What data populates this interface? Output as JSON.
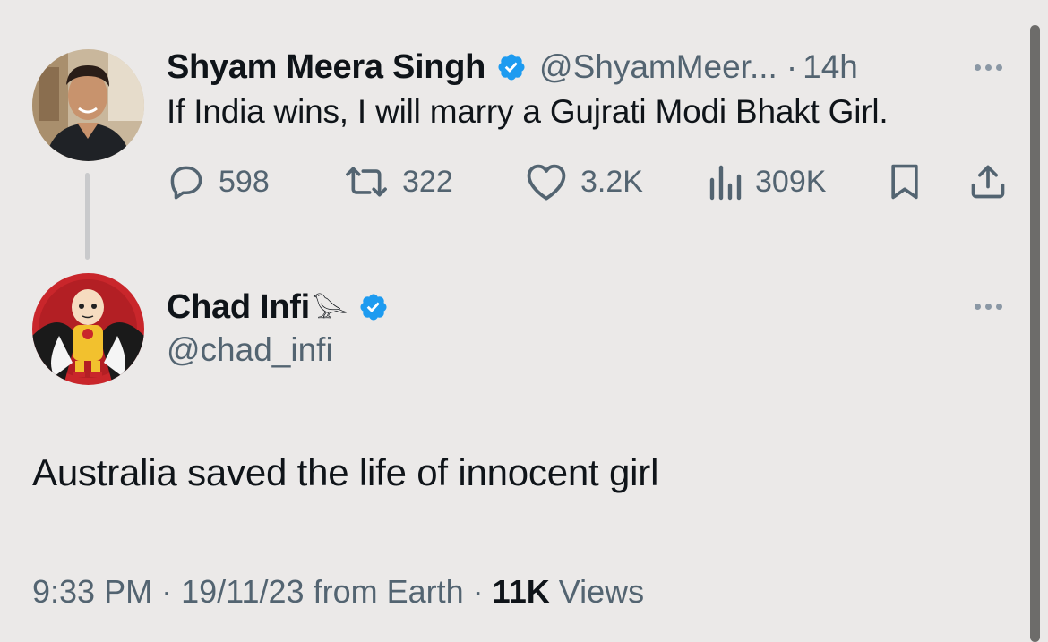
{
  "parent_tweet": {
    "display_name": "Shyam Meera Singh",
    "handle": "@ShyamMeer...",
    "separator": "·",
    "time": "14h",
    "text": "If India wins, I will marry a Gujrati Modi Bhakt Girl.",
    "verified": true,
    "stats": {
      "replies": "598",
      "retweets": "322",
      "likes": "3.2K",
      "views": "309K"
    }
  },
  "reply_tweet": {
    "display_name": "Chad Infi",
    "name_emoji": "𓅪",
    "handle": "@chad_infi",
    "verified": true,
    "text": "Australia saved the life of innocent girl",
    "time": "9:33 PM",
    "separator1": "·",
    "date": "19/11/23",
    "source": "from Earth",
    "separator2": "·",
    "views_count": "11K",
    "views_label": "Views"
  },
  "icons": {
    "verified_badge": "verified-badge-icon",
    "reply": "reply-icon",
    "retweet": "retweet-icon",
    "like": "heart-icon",
    "views": "bar-chart-icon",
    "bookmark": "bookmark-icon",
    "share": "share-icon",
    "more": "more-icon"
  },
  "colors": {
    "background": "#ebe9e8",
    "primary_text": "#0f1419",
    "secondary_text": "#536471",
    "verified_blue": "#1d9bf0"
  }
}
